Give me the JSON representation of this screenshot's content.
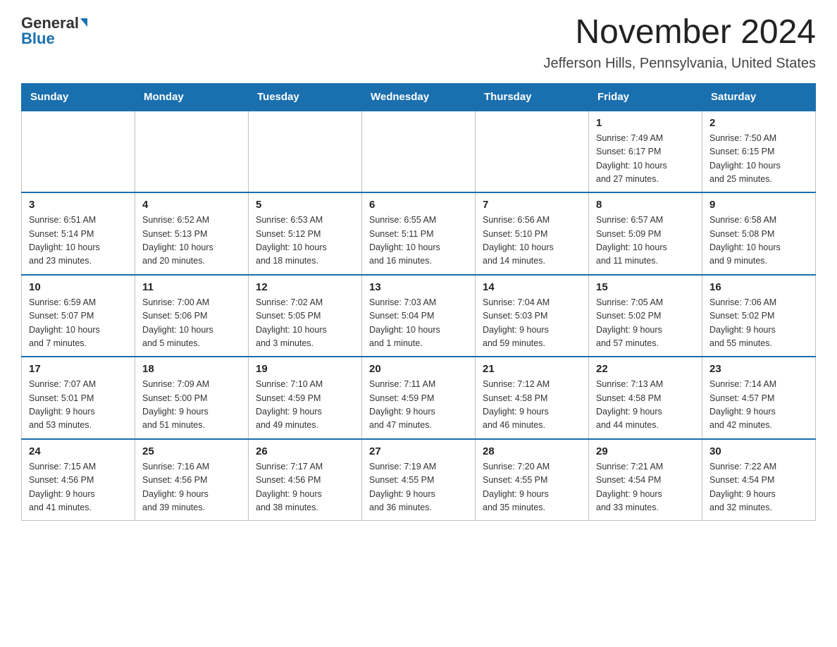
{
  "header": {
    "logo_top": "General",
    "logo_bottom": "Blue",
    "title": "November 2024",
    "subtitle": "Jefferson Hills, Pennsylvania, United States"
  },
  "days_of_week": [
    "Sunday",
    "Monday",
    "Tuesday",
    "Wednesday",
    "Thursday",
    "Friday",
    "Saturday"
  ],
  "weeks": [
    [
      {
        "day": "",
        "info": ""
      },
      {
        "day": "",
        "info": ""
      },
      {
        "day": "",
        "info": ""
      },
      {
        "day": "",
        "info": ""
      },
      {
        "day": "",
        "info": ""
      },
      {
        "day": "1",
        "info": "Sunrise: 7:49 AM\nSunset: 6:17 PM\nDaylight: 10 hours\nand 27 minutes."
      },
      {
        "day": "2",
        "info": "Sunrise: 7:50 AM\nSunset: 6:15 PM\nDaylight: 10 hours\nand 25 minutes."
      }
    ],
    [
      {
        "day": "3",
        "info": "Sunrise: 6:51 AM\nSunset: 5:14 PM\nDaylight: 10 hours\nand 23 minutes."
      },
      {
        "day": "4",
        "info": "Sunrise: 6:52 AM\nSunset: 5:13 PM\nDaylight: 10 hours\nand 20 minutes."
      },
      {
        "day": "5",
        "info": "Sunrise: 6:53 AM\nSunset: 5:12 PM\nDaylight: 10 hours\nand 18 minutes."
      },
      {
        "day": "6",
        "info": "Sunrise: 6:55 AM\nSunset: 5:11 PM\nDaylight: 10 hours\nand 16 minutes."
      },
      {
        "day": "7",
        "info": "Sunrise: 6:56 AM\nSunset: 5:10 PM\nDaylight: 10 hours\nand 14 minutes."
      },
      {
        "day": "8",
        "info": "Sunrise: 6:57 AM\nSunset: 5:09 PM\nDaylight: 10 hours\nand 11 minutes."
      },
      {
        "day": "9",
        "info": "Sunrise: 6:58 AM\nSunset: 5:08 PM\nDaylight: 10 hours\nand 9 minutes."
      }
    ],
    [
      {
        "day": "10",
        "info": "Sunrise: 6:59 AM\nSunset: 5:07 PM\nDaylight: 10 hours\nand 7 minutes."
      },
      {
        "day": "11",
        "info": "Sunrise: 7:00 AM\nSunset: 5:06 PM\nDaylight: 10 hours\nand 5 minutes."
      },
      {
        "day": "12",
        "info": "Sunrise: 7:02 AM\nSunset: 5:05 PM\nDaylight: 10 hours\nand 3 minutes."
      },
      {
        "day": "13",
        "info": "Sunrise: 7:03 AM\nSunset: 5:04 PM\nDaylight: 10 hours\nand 1 minute."
      },
      {
        "day": "14",
        "info": "Sunrise: 7:04 AM\nSunset: 5:03 PM\nDaylight: 9 hours\nand 59 minutes."
      },
      {
        "day": "15",
        "info": "Sunrise: 7:05 AM\nSunset: 5:02 PM\nDaylight: 9 hours\nand 57 minutes."
      },
      {
        "day": "16",
        "info": "Sunrise: 7:06 AM\nSunset: 5:02 PM\nDaylight: 9 hours\nand 55 minutes."
      }
    ],
    [
      {
        "day": "17",
        "info": "Sunrise: 7:07 AM\nSunset: 5:01 PM\nDaylight: 9 hours\nand 53 minutes."
      },
      {
        "day": "18",
        "info": "Sunrise: 7:09 AM\nSunset: 5:00 PM\nDaylight: 9 hours\nand 51 minutes."
      },
      {
        "day": "19",
        "info": "Sunrise: 7:10 AM\nSunset: 4:59 PM\nDaylight: 9 hours\nand 49 minutes."
      },
      {
        "day": "20",
        "info": "Sunrise: 7:11 AM\nSunset: 4:59 PM\nDaylight: 9 hours\nand 47 minutes."
      },
      {
        "day": "21",
        "info": "Sunrise: 7:12 AM\nSunset: 4:58 PM\nDaylight: 9 hours\nand 46 minutes."
      },
      {
        "day": "22",
        "info": "Sunrise: 7:13 AM\nSunset: 4:58 PM\nDaylight: 9 hours\nand 44 minutes."
      },
      {
        "day": "23",
        "info": "Sunrise: 7:14 AM\nSunset: 4:57 PM\nDaylight: 9 hours\nand 42 minutes."
      }
    ],
    [
      {
        "day": "24",
        "info": "Sunrise: 7:15 AM\nSunset: 4:56 PM\nDaylight: 9 hours\nand 41 minutes."
      },
      {
        "day": "25",
        "info": "Sunrise: 7:16 AM\nSunset: 4:56 PM\nDaylight: 9 hours\nand 39 minutes."
      },
      {
        "day": "26",
        "info": "Sunrise: 7:17 AM\nSunset: 4:56 PM\nDaylight: 9 hours\nand 38 minutes."
      },
      {
        "day": "27",
        "info": "Sunrise: 7:19 AM\nSunset: 4:55 PM\nDaylight: 9 hours\nand 36 minutes."
      },
      {
        "day": "28",
        "info": "Sunrise: 7:20 AM\nSunset: 4:55 PM\nDaylight: 9 hours\nand 35 minutes."
      },
      {
        "day": "29",
        "info": "Sunrise: 7:21 AM\nSunset: 4:54 PM\nDaylight: 9 hours\nand 33 minutes."
      },
      {
        "day": "30",
        "info": "Sunrise: 7:22 AM\nSunset: 4:54 PM\nDaylight: 9 hours\nand 32 minutes."
      }
    ]
  ]
}
